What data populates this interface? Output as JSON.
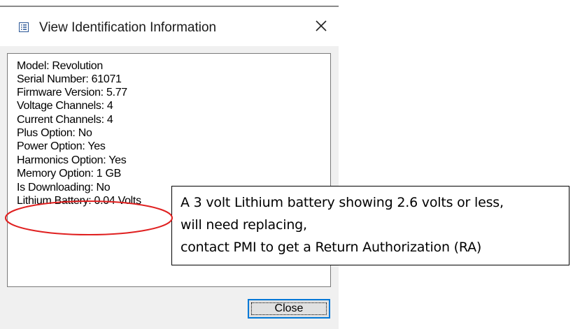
{
  "window": {
    "title": "View Identification Information",
    "close_icon": "close-icon",
    "title_icon": "window-list-icon"
  },
  "info": {
    "lines": [
      "Model:  Revolution",
      "Serial Number:  61071",
      "Firmware Version:  5.77",
      "Voltage Channels:  4",
      "Current Channels:  4",
      "Plus Option:  No",
      "Power Option:  Yes",
      "Harmonics Option:  Yes",
      "Memory Option:  1 GB",
      "Is Downloading:  No",
      "Lithium Battery:  0.04 Volts"
    ]
  },
  "buttons": {
    "close_label": "Close"
  },
  "callout": {
    "lines": [
      "A 3 volt Lithium battery showing 2.6 volts or less,",
      "will need replacing,",
      "contact PMI to get a Return Authorization (RA)"
    ]
  },
  "colors": {
    "highlight": "#e02020",
    "button_focus_border": "#0078d7"
  }
}
